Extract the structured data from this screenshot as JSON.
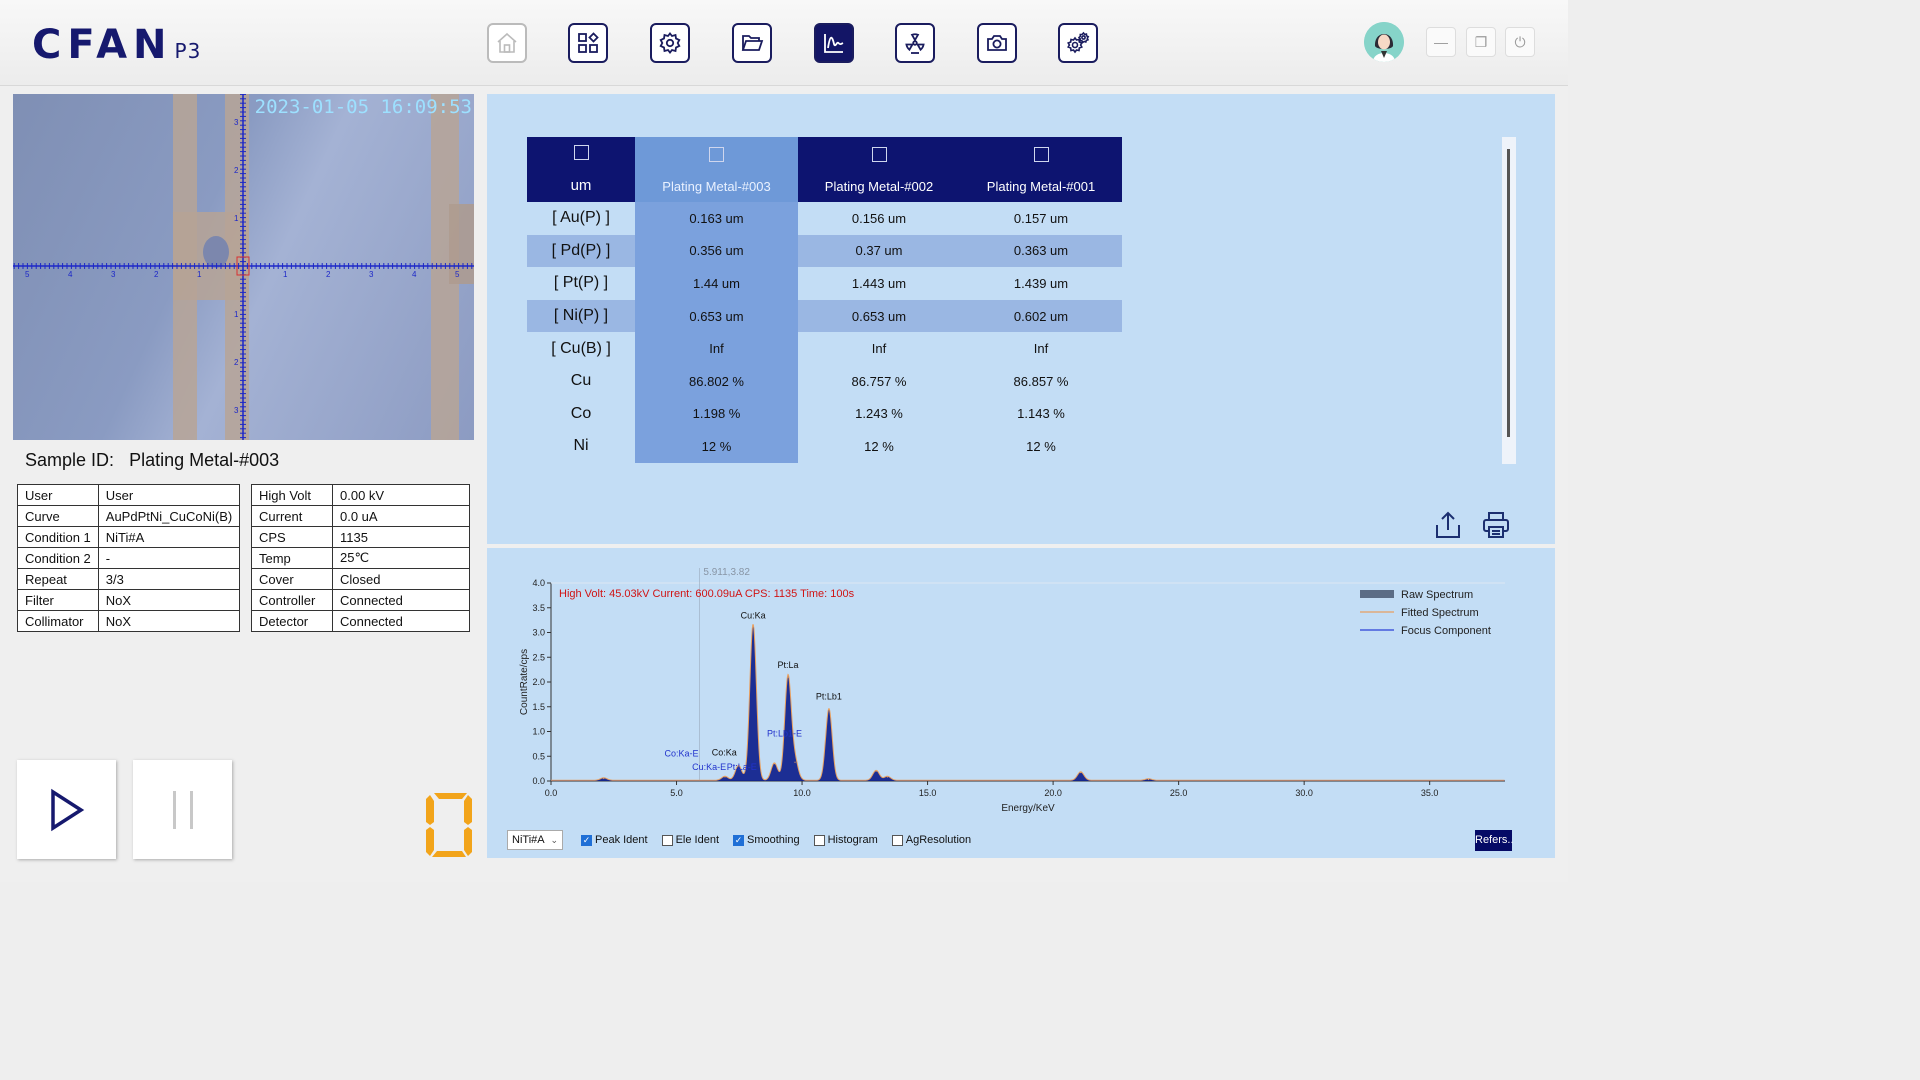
{
  "app": {
    "logo": "CFAN",
    "logo_sub": "P3"
  },
  "toolbar": [
    {
      "name": "home-icon",
      "state": "disabled"
    },
    {
      "name": "grid-apps-icon",
      "state": "normal"
    },
    {
      "name": "settings-gear-icon",
      "state": "normal"
    },
    {
      "name": "folder-open-icon",
      "state": "normal"
    },
    {
      "name": "spectrum-chart-icon",
      "state": "active"
    },
    {
      "name": "radiation-icon",
      "state": "normal"
    },
    {
      "name": "camera-icon",
      "state": "normal"
    },
    {
      "name": "advanced-settings-icon",
      "state": "normal"
    }
  ],
  "camera": {
    "timestamp": "2023-01-05 16:09:53",
    "ruler_h": [
      "5",
      "4",
      "3",
      "2",
      "1",
      "1",
      "2",
      "3",
      "4",
      "5"
    ],
    "ruler_v": [
      "3",
      "2",
      "1",
      "1",
      "2",
      "3"
    ]
  },
  "sample": {
    "label": "Sample ID:",
    "value": "Plating Metal-#003"
  },
  "info_left": [
    [
      "User",
      "User"
    ],
    [
      "Curve",
      "AuPdPtNi_CuCoNi(B)"
    ],
    [
      "Condition 1",
      "NiTi#A"
    ],
    [
      "Condition 2",
      "-"
    ],
    [
      "Repeat",
      "3/3"
    ],
    [
      "Filter",
      "NoX"
    ],
    [
      "Collimator",
      "NoX"
    ]
  ],
  "info_right": [
    [
      "High Volt",
      "0.00 kV"
    ],
    [
      "Current",
      "0.0 uA"
    ],
    [
      "CPS",
      "1135"
    ],
    [
      "Temp",
      "25℃"
    ],
    [
      "Cover",
      "Closed"
    ],
    [
      "Controller",
      "Connected"
    ],
    [
      "Detector",
      "Connected"
    ]
  ],
  "results": {
    "unit": "um",
    "columns": [
      "Plating Metal-#003",
      "Plating Metal-#002",
      "Plating Metal-#001"
    ],
    "rows": [
      {
        "label": "[ Au(P) ]",
        "values": [
          "0.163 um",
          "0.156 um",
          "0.157 um"
        ]
      },
      {
        "label": "[ Pd(P) ]",
        "values": [
          "0.356 um",
          "0.37 um",
          "0.363 um"
        ]
      },
      {
        "label": "[ Pt(P) ]",
        "values": [
          "1.44 um",
          "1.443 um",
          "1.439 um"
        ]
      },
      {
        "label": "[ Ni(P) ]",
        "values": [
          "0.653 um",
          "0.653 um",
          "0.602 um"
        ]
      },
      {
        "label": "[ Cu(B) ]",
        "values": [
          "Inf",
          "Inf",
          "Inf"
        ]
      },
      {
        "label": "Cu",
        "values": [
          "86.802 %",
          "86.757 %",
          "86.857 %"
        ]
      },
      {
        "label": "Co",
        "values": [
          "1.198 %",
          "1.243 %",
          "1.143 %"
        ]
      },
      {
        "label": "Ni",
        "values": [
          "12 %",
          "12 %",
          "12 %"
        ]
      }
    ]
  },
  "spectrum_options": {
    "condition": "NiTi#A",
    "checks": [
      {
        "label": "Peak Ident",
        "checked": true
      },
      {
        "label": "Ele Ident",
        "checked": false
      },
      {
        "label": "Smoothing",
        "checked": true
      },
      {
        "label": "Histogram",
        "checked": false
      },
      {
        "label": "AgResolution",
        "checked": false
      }
    ],
    "refers": "Refers.."
  },
  "chart_data": {
    "type": "line",
    "info": "High Volt: 45.03kV  Current: 600.09uA  CPS: 1135  Time: 100s",
    "cursor": "5.911,3.82",
    "xlabel": "Energy/KeV",
    "ylabel": "CountRate/cps",
    "xlim": [
      0,
      38
    ],
    "ylim": [
      0,
      4.0
    ],
    "xticks": [
      "0.0",
      "5.0",
      "10.0",
      "15.0",
      "20.0",
      "25.0",
      "30.0",
      "35.0"
    ],
    "yticks": [
      "0.0",
      "0.5",
      "1.0",
      "1.5",
      "2.0",
      "2.5",
      "3.0",
      "3.5",
      "4.0"
    ],
    "legend": [
      "Raw Spectrum",
      "Fitted Spectrum",
      "Focus Component"
    ],
    "legend_colors": [
      "#5c6d86",
      "#e8a060",
      "#2a3fd6"
    ],
    "peaks": [
      {
        "x": 2.1,
        "y": 0.05
      },
      {
        "x": 6.93,
        "y": 0.08
      },
      {
        "x": 7.47,
        "y": 0.3
      },
      {
        "x": 8.05,
        "y": 3.15
      },
      {
        "x": 8.9,
        "y": 0.35
      },
      {
        "x": 9.44,
        "y": 2.1
      },
      {
        "x": 9.72,
        "y": 0.38
      },
      {
        "x": 11.07,
        "y": 1.45
      },
      {
        "x": 12.95,
        "y": 0.2
      },
      {
        "x": 13.4,
        "y": 0.08
      },
      {
        "x": 21.1,
        "y": 0.17
      },
      {
        "x": 23.8,
        "y": 0.03
      }
    ],
    "annotations": [
      {
        "text": "Cu:Ka",
        "x": 8.05,
        "y": 3.28,
        "color": "#111"
      },
      {
        "text": "Pt:La",
        "x": 9.44,
        "y": 2.28,
        "color": "#111"
      },
      {
        "text": "Pt:Lb1",
        "x": 11.07,
        "y": 1.65,
        "color": "#111"
      },
      {
        "text": "Pt:Lb1-E",
        "x": 9.3,
        "y": 0.9,
        "color": "#2233cc"
      },
      {
        "text": "Co:Ka-E",
        "x": 5.2,
        "y": 0.5,
        "color": "#2233cc"
      },
      {
        "text": "Co:Ka",
        "x": 6.9,
        "y": 0.52,
        "color": "#111"
      },
      {
        "text": "Cu:Ka-E",
        "x": 6.3,
        "y": 0.22,
        "color": "#2233cc"
      },
      {
        "text": "Pt:La-E",
        "x": 7.6,
        "y": 0.22,
        "color": "#2233cc"
      }
    ]
  }
}
